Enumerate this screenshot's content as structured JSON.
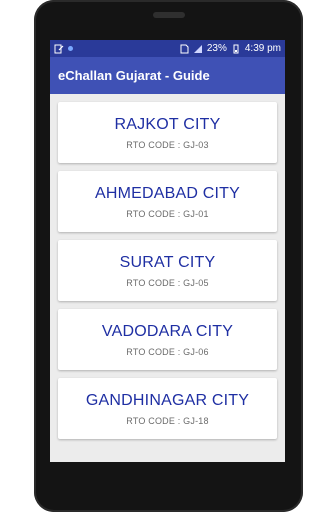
{
  "app": {
    "title": "eChallan Gujarat - Guide"
  },
  "status_bar": {
    "battery_percent": "23%",
    "time": "4:39 pm",
    "colors": {
      "status_bg": "#2a3a99",
      "appbar_bg": "#3f51b5"
    }
  },
  "cities": [
    {
      "name": "RAJKOT CITY",
      "rto_code": "RTO CODE : GJ-03"
    },
    {
      "name": "AHMEDABAD CITY",
      "rto_code": "RTO CODE : GJ-01"
    },
    {
      "name": "SURAT CITY",
      "rto_code": "RTO CODE : GJ-05"
    },
    {
      "name": "VADODARA CITY",
      "rto_code": "RTO CODE : GJ-06"
    },
    {
      "name": "GANDHINAGAR CITY",
      "rto_code": "RTO CODE : GJ-18"
    }
  ],
  "icons": {
    "status_left": [
      "edit-icon",
      "notification-dot-icon"
    ],
    "status_right": [
      "sim-icon",
      "signal-icon"
    ]
  },
  "theme": {
    "city_text": "#1f2fa3",
    "card_bg": "#ffffff",
    "screen_bg": "#ececec"
  }
}
